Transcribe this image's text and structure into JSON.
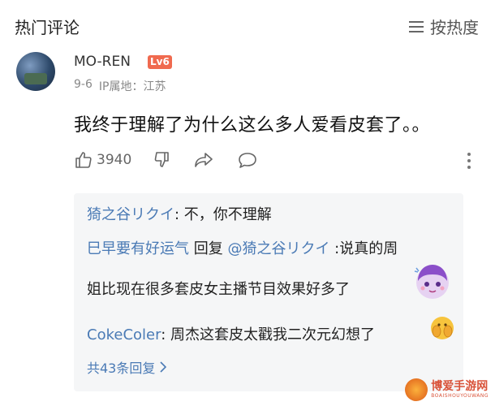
{
  "header": {
    "title": "热门评论",
    "sort_label": "按热度"
  },
  "comment": {
    "username": "MO-REN",
    "level": "Lv6",
    "date": "9-6",
    "ip_location": "IP属地：江苏",
    "text": "我终于理解了为什么这么多人爱看皮套了。。",
    "like_count": "3940"
  },
  "replies": [
    {
      "name": "猗之谷リクイ",
      "separator": ": ",
      "text": "不，你不理解"
    },
    {
      "name": "巳早要有好运气",
      "text_prefix": " 回复 ",
      "mention": "@猗之谷リクイ",
      "text": " :说真的周"
    },
    {
      "text": "姐比现在很多套皮女主播节目效果好多了"
    },
    {
      "name": "CokeColer",
      "separator": ": ",
      "text": "周杰这套皮太戳我二次元幻想了"
    }
  ],
  "more_replies": "共43条回复",
  "watermark": {
    "title": "博爱手游网",
    "subtitle": "BOAISHOUYOUWANG"
  }
}
